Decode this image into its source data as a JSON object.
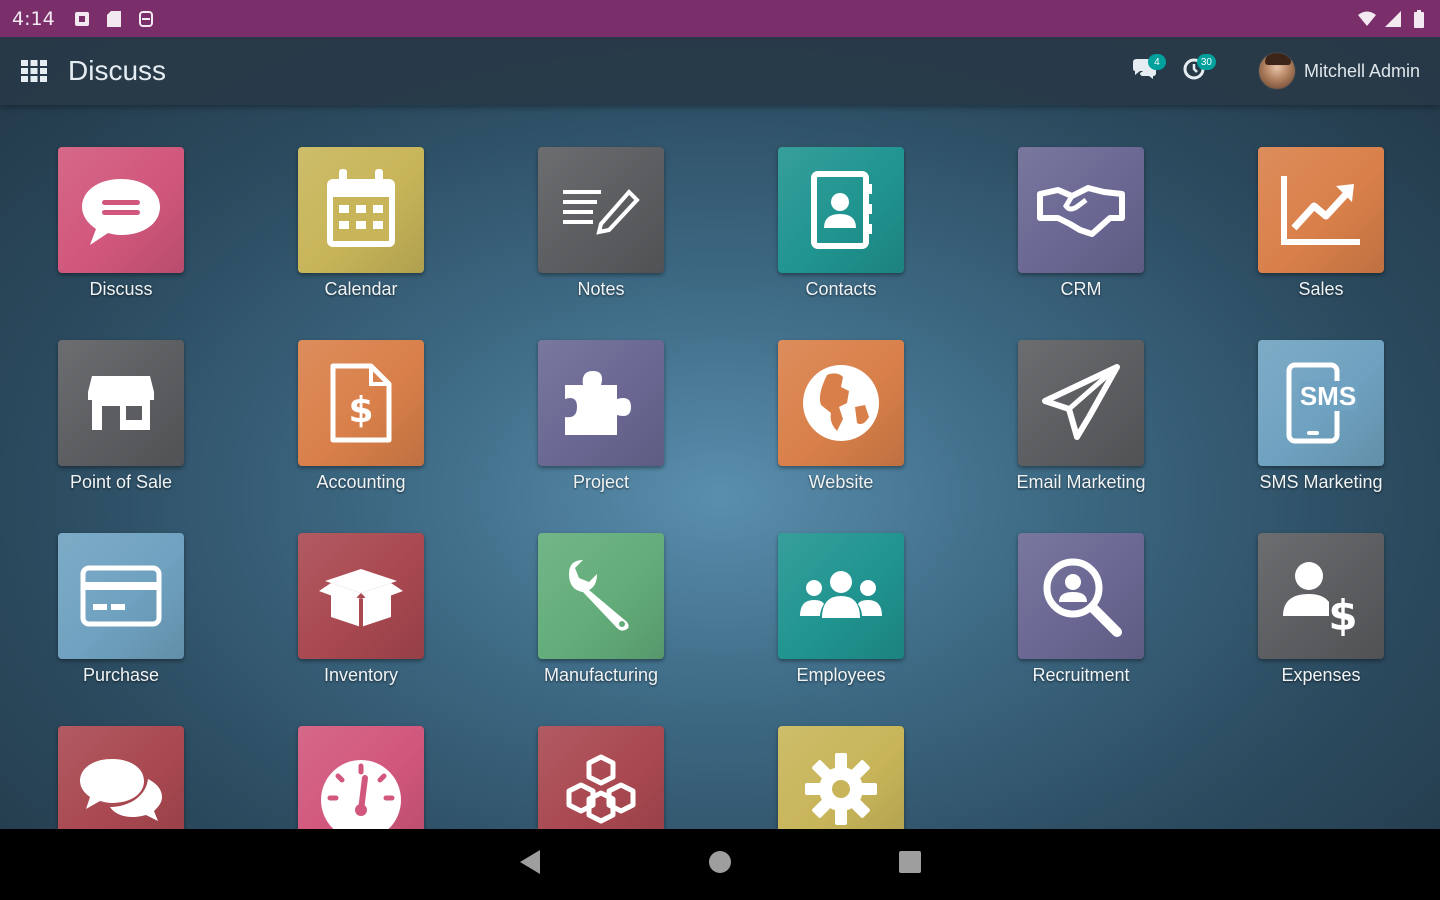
{
  "status_bar": {
    "time": "4:14",
    "left_icons": [
      "notification-icon",
      "sd-card-icon",
      "sync-icon"
    ],
    "right_icons": [
      "wifi-icon",
      "cell-signal-icon",
      "battery-icon"
    ]
  },
  "navbar": {
    "menu_icon": "apps-grid-icon",
    "title": "Discuss",
    "messages_badge": "4",
    "activities_badge": "30",
    "user_name": "Mitchell Admin"
  },
  "apps": [
    {
      "label": "Discuss",
      "icon": "chat-bubble-icon",
      "color": "#d1577c"
    },
    {
      "label": "Calendar",
      "icon": "calendar-icon",
      "color": "#c8b559"
    },
    {
      "label": "Notes",
      "icon": "notes-pencil-icon",
      "color": "#5b5d60"
    },
    {
      "label": "Contacts",
      "icon": "address-book-icon",
      "color": "#209490"
    },
    {
      "label": "CRM",
      "icon": "handshake-icon",
      "color": "#6a6893"
    },
    {
      "label": "Sales",
      "icon": "trending-chart-icon",
      "color": "#d9804a"
    },
    {
      "label": "Point of Sale",
      "icon": "storefront-icon",
      "color": "#5b5d60"
    },
    {
      "label": "Accounting",
      "icon": "invoice-dollar-icon",
      "color": "#d9804a"
    },
    {
      "label": "Project",
      "icon": "puzzle-icon",
      "color": "#6a6893"
    },
    {
      "label": "Website",
      "icon": "globe-icon",
      "color": "#d9804a"
    },
    {
      "label": "Email Marketing",
      "icon": "paper-plane-icon",
      "color": "#5b5d60"
    },
    {
      "label": "SMS Marketing",
      "icon": "sms-phone-icon",
      "color": "#6fa2c0"
    },
    {
      "label": "Purchase",
      "icon": "credit-card-icon",
      "color": "#6fa2c0"
    },
    {
      "label": "Inventory",
      "icon": "open-box-icon",
      "color": "#a94850"
    },
    {
      "label": "Manufacturing",
      "icon": "wrench-icon",
      "color": "#63ad7a"
    },
    {
      "label": "Employees",
      "icon": "people-group-icon",
      "color": "#209490"
    },
    {
      "label": "Recruitment",
      "icon": "magnifier-person-icon",
      "color": "#6a6893"
    },
    {
      "label": "Expenses",
      "icon": "person-dollar-icon",
      "color": "#5b5d60"
    },
    {
      "label": "",
      "icon": "live-chat-icon",
      "color": "#a94850"
    },
    {
      "label": "",
      "icon": "dashboard-gauge-icon",
      "color": "#d1577c"
    },
    {
      "label": "",
      "icon": "cubes-icon",
      "color": "#a94850"
    },
    {
      "label": "",
      "icon": "settings-gear-icon",
      "color": "#c8b559"
    }
  ],
  "android_nav": [
    "back-icon",
    "home-icon",
    "recents-icon"
  ]
}
